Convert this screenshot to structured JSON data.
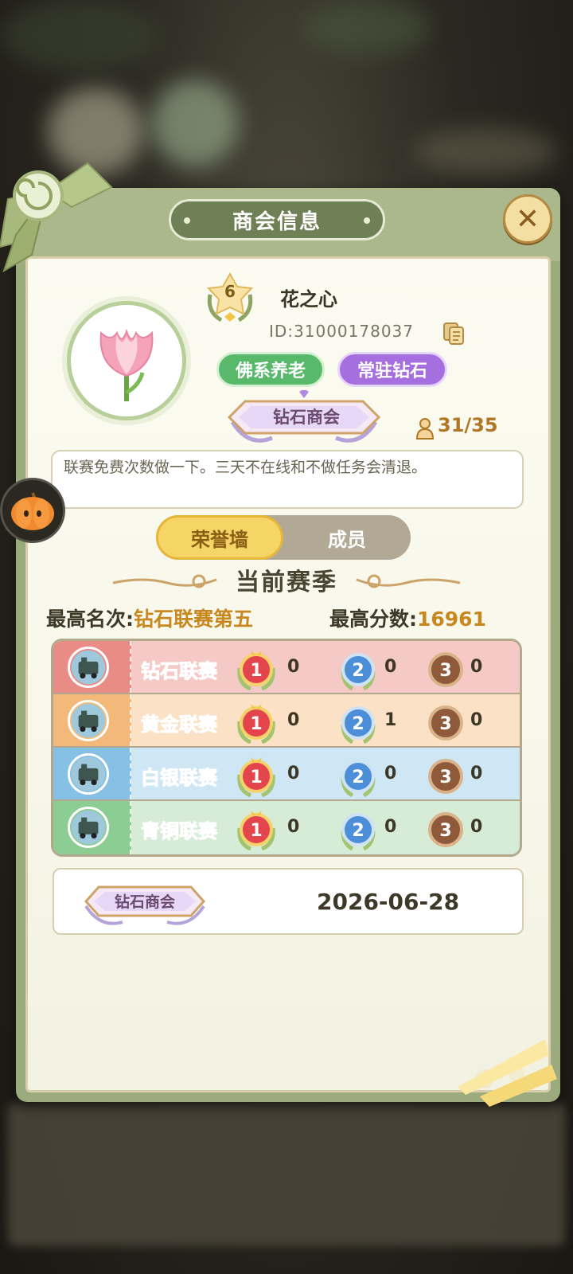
{
  "dialog": {
    "title": "商会信息",
    "close_icon": "close-icon"
  },
  "guild": {
    "level": "6",
    "name": "花之心",
    "id_text": "ID:31000178037",
    "tags": [
      "佛系养老",
      "常驻钻石"
    ],
    "rank_emblem": "钻石商会",
    "members": "31/35",
    "notice": "联赛免费次数做一下。三天不在线和不做任务会清退。"
  },
  "tabs": {
    "active": "荣誉墙",
    "inactive": "成员"
  },
  "season": {
    "title": "当前赛季",
    "best_rank_label": "最高名次:",
    "best_rank_value": "钻石联赛第五",
    "best_score_label": "最高分数:",
    "best_score_value": "16961"
  },
  "leagues": [
    {
      "name": "钻石联赛",
      "gold": "0",
      "silver": "0",
      "bronze": "0",
      "row_color": "#f4c9c6",
      "left_color": "#e98c86",
      "name_color": "#e0788e"
    },
    {
      "name": "黄金联赛",
      "gold": "0",
      "silver": "1",
      "bronze": "0",
      "row_color": "#fbe1c6",
      "left_color": "#f3b97a",
      "name_color": "#ef9c32"
    },
    {
      "name": "白银联赛",
      "gold": "0",
      "silver": "0",
      "bronze": "0",
      "row_color": "#cfe6f4",
      "left_color": "#86c1e5",
      "name_color": "#6a9cc8"
    },
    {
      "name": "青铜联赛",
      "gold": "0",
      "silver": "0",
      "bronze": "0",
      "row_color": "#d6ecd6",
      "left_color": "#8ccd93",
      "name_color": "#c08636"
    }
  ],
  "history": {
    "emblem": "钻石商会",
    "date": "2026-06-28"
  }
}
